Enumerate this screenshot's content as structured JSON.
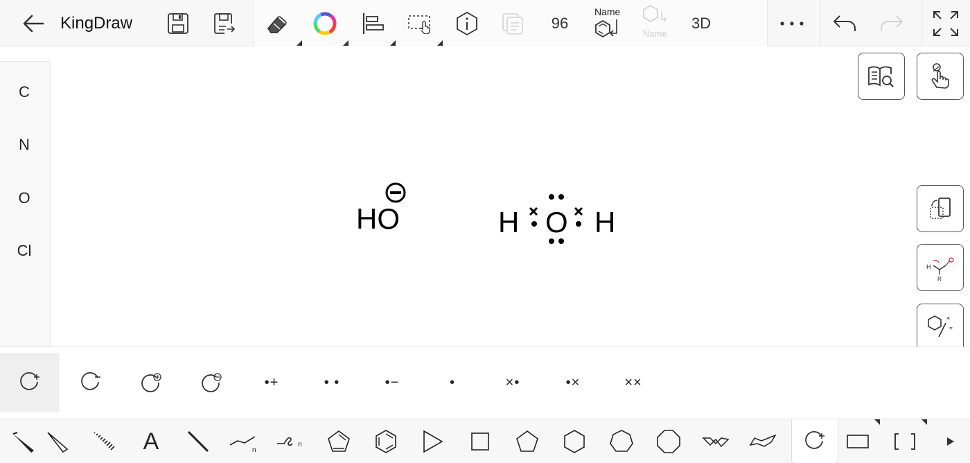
{
  "app": {
    "title": "KingDraw"
  },
  "toolbar": {
    "back": "back-arrow-icon",
    "save": "save-icon",
    "save_as": "save-as-icon",
    "eraser": "eraser-icon",
    "color": "color-wheel-icon",
    "align": "align-icon",
    "select": "select-region-icon",
    "info": "info-hexagon-icon",
    "copy": "copy-icon",
    "count_label": "96",
    "name_label": "Name",
    "name_disabled_label": "Name",
    "three_d_label": "3D",
    "more": "more-dots-icon",
    "undo": "undo-icon",
    "redo": "redo-icon",
    "fullscreen": "fullscreen-icon"
  },
  "elements": [
    {
      "label": "C"
    },
    {
      "label": "N"
    },
    {
      "label": "O"
    },
    {
      "label": "Cl"
    }
  ],
  "canvas": {
    "hydroxide": {
      "label": "HO",
      "charge": "negative-charge-icon"
    },
    "water": {
      "left_h": "H",
      "center_o": "O",
      "right_h": "H"
    }
  },
  "side_buttons": [
    {
      "name": "search-structure-button",
      "icon": "book-search-icon"
    },
    {
      "name": "touch-mode-button",
      "icon": "hand-pointer-icon"
    },
    {
      "name": "rotate-screen-button",
      "icon": "rotate-screen-icon"
    },
    {
      "name": "reaction-template-button",
      "icon": "reaction-mechanism-icon",
      "h_label": "H",
      "r_label": "R"
    },
    {
      "name": "stereo-button",
      "icon": "hexagon-star-icon"
    }
  ],
  "electron_tools": [
    {
      "name": "radical-cation",
      "text": ""
    },
    {
      "name": "radical-anion",
      "text": ""
    },
    {
      "name": "circled-plus",
      "text": ""
    },
    {
      "name": "circled-minus",
      "text": ""
    },
    {
      "name": "dot-plus",
      "text": "•+"
    },
    {
      "name": "lone-pair",
      "text": "• •"
    },
    {
      "name": "dot-minus",
      "text": "•−"
    },
    {
      "name": "single-dot",
      "text": "•"
    },
    {
      "name": "cross-dot",
      "text": "×•"
    },
    {
      "name": "dot-cross",
      "text": "•×"
    },
    {
      "name": "cross-cross",
      "text": "××"
    }
  ],
  "draw_tools": [
    "wedge-bond",
    "hollow-wedge-bond",
    "hash-bond",
    "text-tool",
    "single-bond",
    "chain-tool",
    "wavy-chain-tool",
    "cyclopentadiene",
    "benzene",
    "triangle",
    "square",
    "pentagon",
    "hexagon",
    "heptagon",
    "octagon",
    "chair-cyclohexane",
    "boat-cyclohexane",
    "electron-tool",
    "rectangle-shape",
    "bracket-shape",
    "more-tools"
  ],
  "draw_tool_labels": {
    "chain_n": "n",
    "wavy_n": "n",
    "text_a": "A"
  },
  "colors": {
    "accent_dark": "#333333",
    "toolbar_bg": "#f7f7f7"
  }
}
